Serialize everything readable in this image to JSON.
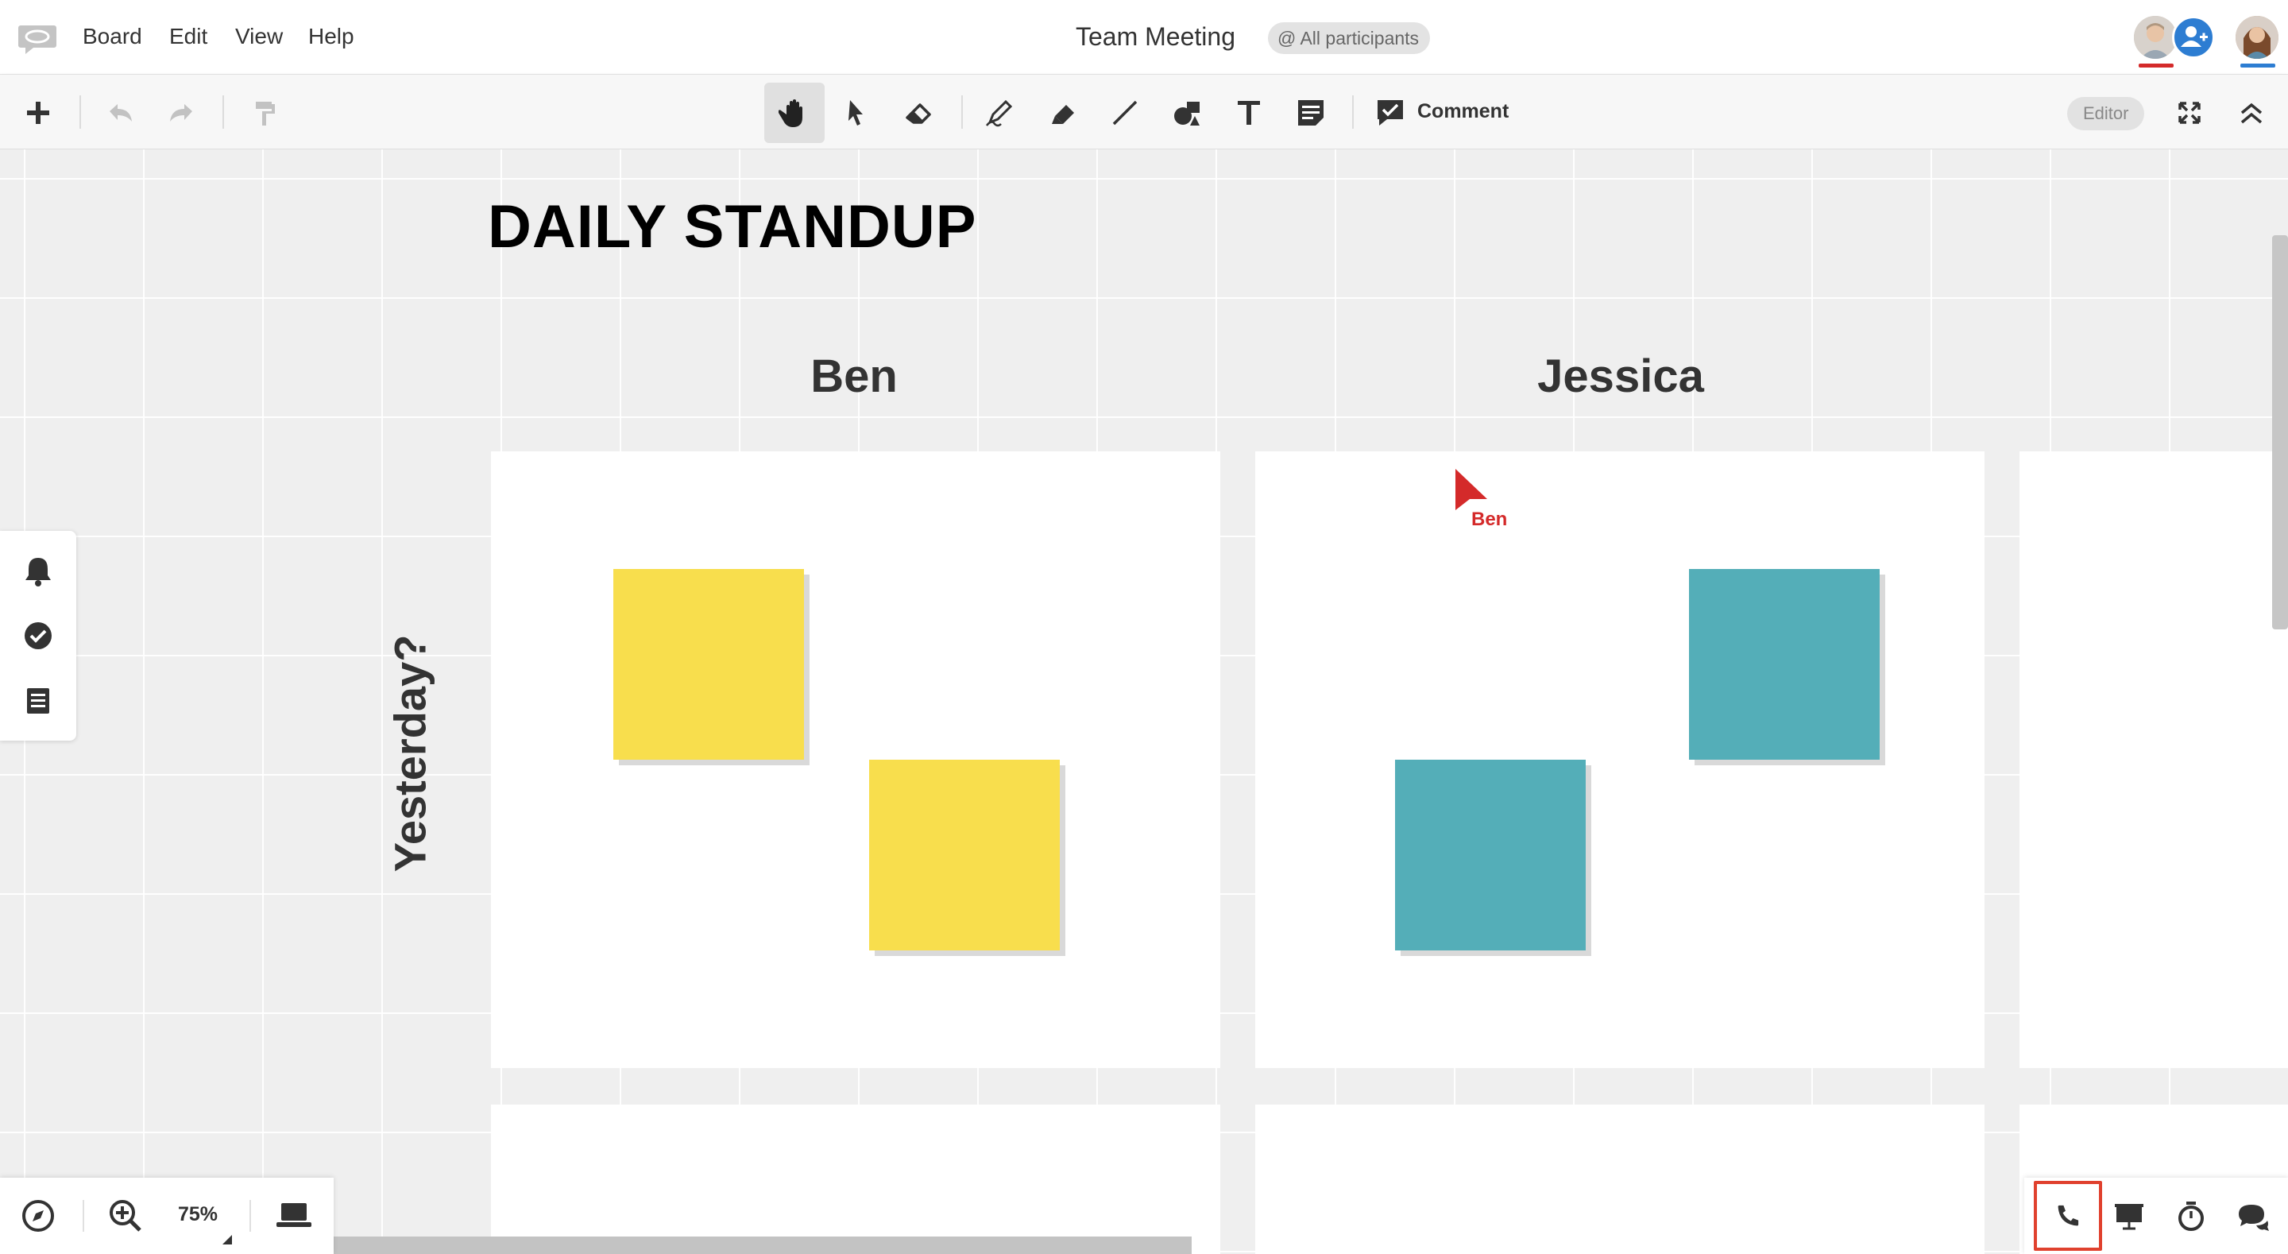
{
  "menubar": {
    "items": [
      "Board",
      "Edit",
      "View",
      "Help"
    ],
    "board_title": "Team Meeting",
    "participants_label": "@ All participants"
  },
  "toolbar": {
    "comment_label": "Comment",
    "editor_label": "Editor",
    "icons": [
      "add-icon",
      "undo-icon",
      "redo-icon",
      "format-painter-icon",
      "hand-icon",
      "select-arrow-icon",
      "eraser-icon",
      "pen-icon",
      "marker-icon",
      "line-icon",
      "shapes-icon",
      "text-icon",
      "sticky-note-icon",
      "comment-icon",
      "fullscreen-icon",
      "collapse-icon"
    ],
    "active_tool": "hand"
  },
  "board": {
    "heading": "DAILY STANDUP",
    "columns": [
      "Ben",
      "Jessica"
    ],
    "rows": [
      "Yesterday?"
    ],
    "remote_cursor_label": "Ben",
    "sticky_colors": {
      "ben": "#f8de4d",
      "jessica": "#54aeb8"
    }
  },
  "bottom": {
    "zoom_level": "75%"
  },
  "colors": {
    "accent_blue": "#2d7dd2",
    "cursor_red": "#d42a2a",
    "highlight_red": "#e0412e"
  }
}
